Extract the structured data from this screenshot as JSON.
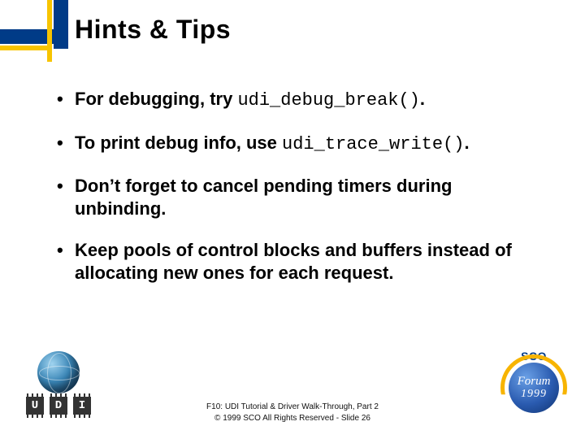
{
  "title": "Hints & Tips",
  "bullets": {
    "b0": {
      "pre": "For debugging, try ",
      "code": "udi_debug_break()",
      "post": "."
    },
    "b1": {
      "pre": "To print debug info, use ",
      "code": "udi_trace_write()",
      "post": "."
    },
    "b2": {
      "text": "Don’t forget to cancel pending timers during unbinding."
    },
    "b3": {
      "text": "Keep pools of control blocks and buffers instead of allocating new ones for each request."
    }
  },
  "footer": {
    "line1": "F10: UDI Tutorial & Driver Walk-Through, Part 2",
    "line2": "© 1999 SCO  All Rights Reserved - Slide 26"
  },
  "logos": {
    "udi": {
      "letters": {
        "u": "U",
        "d": "D",
        "i": "I"
      }
    },
    "sco": {
      "top": "SCO",
      "word": "Forum",
      "year": "1999"
    }
  },
  "colors": {
    "accent_blue": "#003b87",
    "accent_yellow": "#f7c400"
  }
}
